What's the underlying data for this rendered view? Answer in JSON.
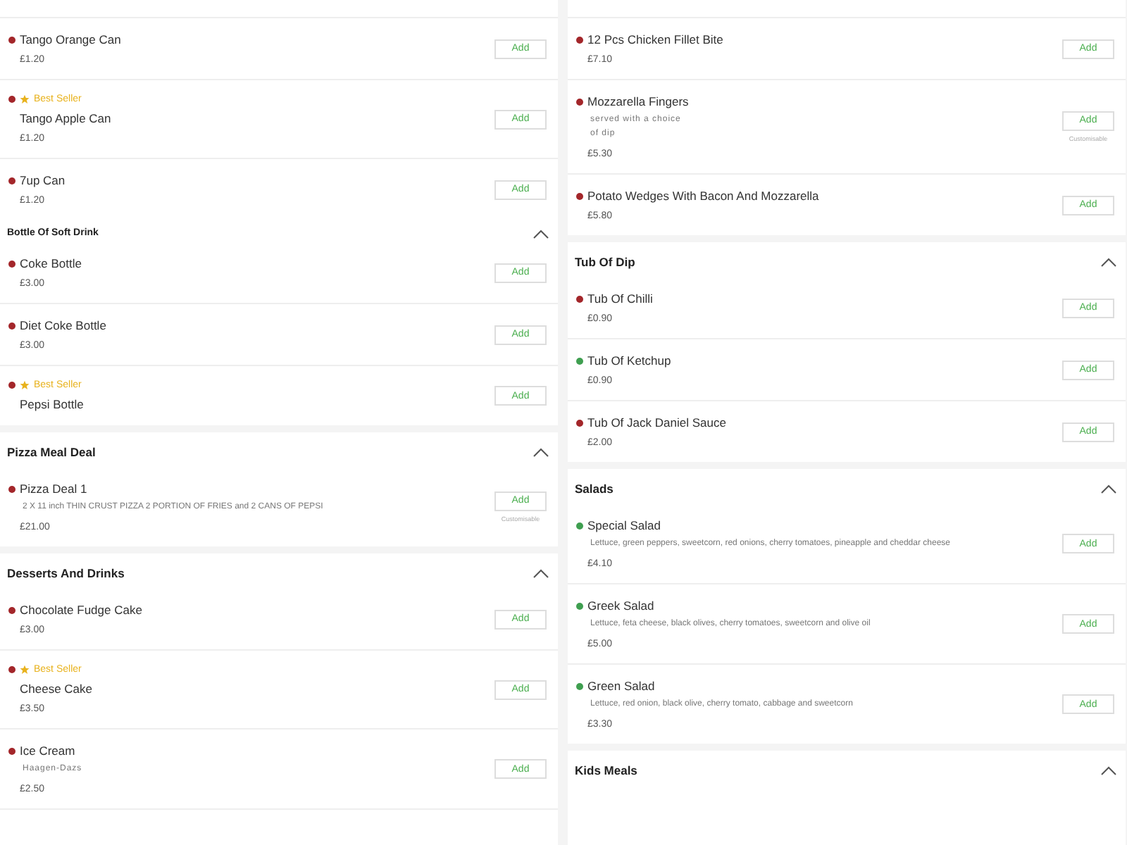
{
  "columns": [
    {
      "entries": [
        {
          "kind": "item",
          "name": "Tango Orange Can",
          "price": "£1.20",
          "color": "#a3262a",
          "best_seller": false,
          "button": "Add"
        },
        {
          "kind": "item",
          "name": "Tango Apple Can",
          "price": "£1.20",
          "color": "#a3262a",
          "best_seller": true,
          "badge": "Best Seller",
          "button": "Add"
        },
        {
          "kind": "item",
          "name": "7up Can",
          "price": "£1.20",
          "color": "#a3262a",
          "best_seller": false,
          "button": "Add"
        },
        {
          "kind": "subheader",
          "title": "Bottle Of Soft Drink",
          "expanded": true
        },
        {
          "kind": "item",
          "name": "Coke Bottle",
          "price": "£3.00",
          "color": "#a3262a",
          "best_seller": false,
          "button": "Add"
        },
        {
          "kind": "item",
          "name": "Diet Coke Bottle",
          "price": "£3.00",
          "color": "#a3262a",
          "best_seller": false,
          "button": "Add"
        },
        {
          "kind": "item",
          "name": "Pepsi Bottle",
          "color": "#a3262a",
          "best_seller": true,
          "badge": "Best Seller",
          "button": "Add"
        },
        {
          "kind": "header",
          "title": "Pizza Meal Deal",
          "expanded": true
        },
        {
          "kind": "item",
          "name": "Pizza Deal 1",
          "description": "2 X 11 inch THIN CRUST PIZZA 2 PORTION OF FRIES and 2 CANS OF PEPSI",
          "narrow": false,
          "price": "£21.00",
          "color": "#a3262a",
          "best_seller": false,
          "button": "Add",
          "note": "Customisable"
        },
        {
          "kind": "header",
          "title": "Desserts And Drinks",
          "expanded": true
        },
        {
          "kind": "item",
          "name": "Chocolate Fudge Cake",
          "price": "£3.00",
          "color": "#a3262a",
          "best_seller": false,
          "button": "Add"
        },
        {
          "kind": "item",
          "name": "Cheese Cake",
          "price": "£3.50",
          "color": "#a3262a",
          "best_seller": true,
          "badge": "Best Seller",
          "button": "Add"
        },
        {
          "kind": "item",
          "name": "Ice Cream",
          "description": "Haagen-Dazs",
          "narrow": true,
          "price": "£2.50",
          "color": "#a3262a",
          "best_seller": false,
          "button": "Add"
        }
      ]
    },
    {
      "entries": [
        {
          "kind": "item",
          "name": "12 Pcs Chicken Fillet Bite",
          "price": "£7.10",
          "color": "#a3262a",
          "best_seller": false,
          "button": "Add"
        },
        {
          "kind": "item",
          "name": "Mozzarella Fingers",
          "description": "served with a choice of dip",
          "narrow": true,
          "price": "£5.30",
          "color": "#a3262a",
          "best_seller": false,
          "button": "Add",
          "note": "Customisable"
        },
        {
          "kind": "item",
          "name": "Potato Wedges With Bacon And Mozzarella",
          "price": "£5.80",
          "color": "#a3262a",
          "best_seller": false,
          "button": "Add"
        },
        {
          "kind": "header",
          "title": "Tub Of Dip",
          "expanded": true
        },
        {
          "kind": "item",
          "name": "Tub Of Chilli",
          "price": "£0.90",
          "color": "#a3262a",
          "best_seller": false,
          "button": "Add"
        },
        {
          "kind": "item",
          "name": "Tub Of Ketchup",
          "price": "£0.90",
          "color": "#3f9f50",
          "best_seller": false,
          "button": "Add"
        },
        {
          "kind": "item",
          "name": "Tub Of Jack Daniel Sauce",
          "price": "£2.00",
          "color": "#a3262a",
          "best_seller": false,
          "button": "Add"
        },
        {
          "kind": "header",
          "title": "Salads",
          "expanded": true
        },
        {
          "kind": "item",
          "name": "Special Salad",
          "description": "Lettuce, green peppers, sweetcorn, red onions, cherry tomatoes, pineapple and cheddar cheese",
          "narrow": false,
          "price": "£4.10",
          "color": "#3f9f50",
          "best_seller": false,
          "button": "Add"
        },
        {
          "kind": "item",
          "name": "Greek Salad",
          "description": "Lettuce, feta cheese, black olives, cherry tomatoes, sweetcorn and olive oil",
          "narrow": false,
          "price": "£5.00",
          "color": "#3f9f50",
          "best_seller": false,
          "button": "Add"
        },
        {
          "kind": "item",
          "name": "Green Salad",
          "description": "Lettuce, red onion, black olive, cherry tomato, cabbage and sweetcorn",
          "narrow": false,
          "price": "£3.30",
          "color": "#3f9f50",
          "best_seller": false,
          "button": "Add"
        },
        {
          "kind": "header",
          "title": "Kids Meals",
          "expanded": true
        }
      ]
    }
  ]
}
